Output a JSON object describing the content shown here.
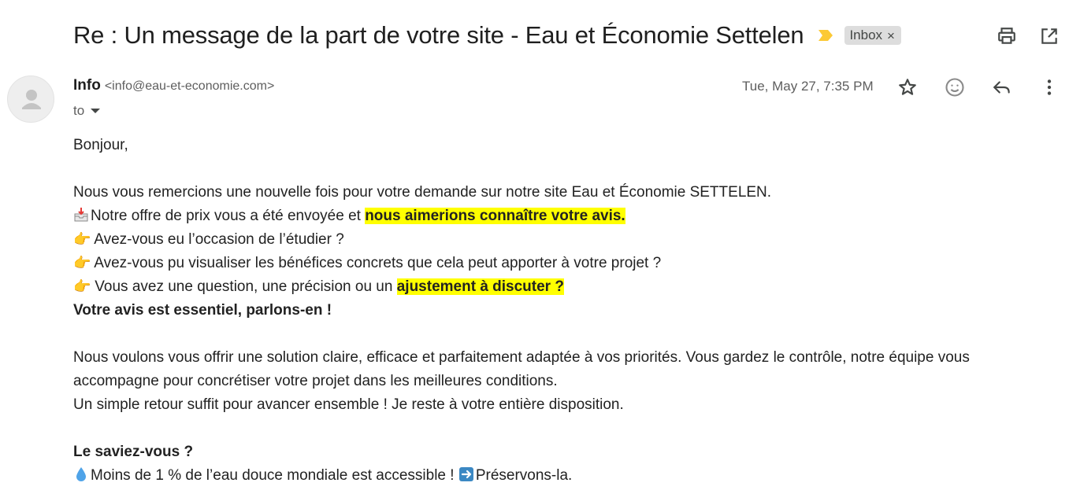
{
  "subject": "Re : Un message de la part de votre site - Eau et Économie Settelen",
  "label": {
    "name": "Inbox",
    "close": "×"
  },
  "sender": {
    "name": "Info",
    "email": "<info@eau-et-economie.com>",
    "to_label": "to",
    "date": "Tue, May 27, 7:35 PM"
  },
  "icons": {
    "important": "importance-marker-icon",
    "print": "print-icon",
    "open_new_window": "open-in-new-window-icon",
    "star": "star-icon",
    "emoji": "emoji-reaction-icon",
    "reply": "reply-icon",
    "more": "more-vertical-icon"
  },
  "colors": {
    "highlight": "#ffff00",
    "important_marker": "#fcc934",
    "text": "#222222",
    "muted": "#5e5e5e"
  },
  "body": {
    "greeting": "Bonjour,",
    "line1": "Nous vous remercions une nouvelle fois pour votre demande sur notre site Eau et Économie SETTELEN.",
    "line2_prefix": "Notre offre de prix vous a été envoyée et ",
    "line2_highlight": "nous aimerions connaître votre avis.",
    "bullet1": "Avez-vous eu l’occasion de l’étudier ?",
    "bullet2": "Avez-vous pu visualiser les bénéfices concrets que cela peut apporter à votre projet ?",
    "bullet3_prefix": "Vous avez une question, une précision ou un ",
    "bullet3_highlight": "ajustement à discuter ?",
    "bold_line": "Votre avis est essentiel, parlons-en !",
    "para2_line1": "Nous voulons vous offrir une solution claire, efficace et parfaitement adaptée à vos priorités. Vous gardez le contrôle, notre équipe vous",
    "para2_line2": "accompagne pour concrétiser votre projet dans les meilleures conditions.",
    "para2_line3": "Un simple retour suffit pour avancer ensemble ! Je reste à votre entière disposition.",
    "did_you_know": "Le saviez-vous ?",
    "fact_text": "Moins de 1 % de l’eau douce mondiale est accessible ! ",
    "fact_end": "Préservons-la."
  }
}
